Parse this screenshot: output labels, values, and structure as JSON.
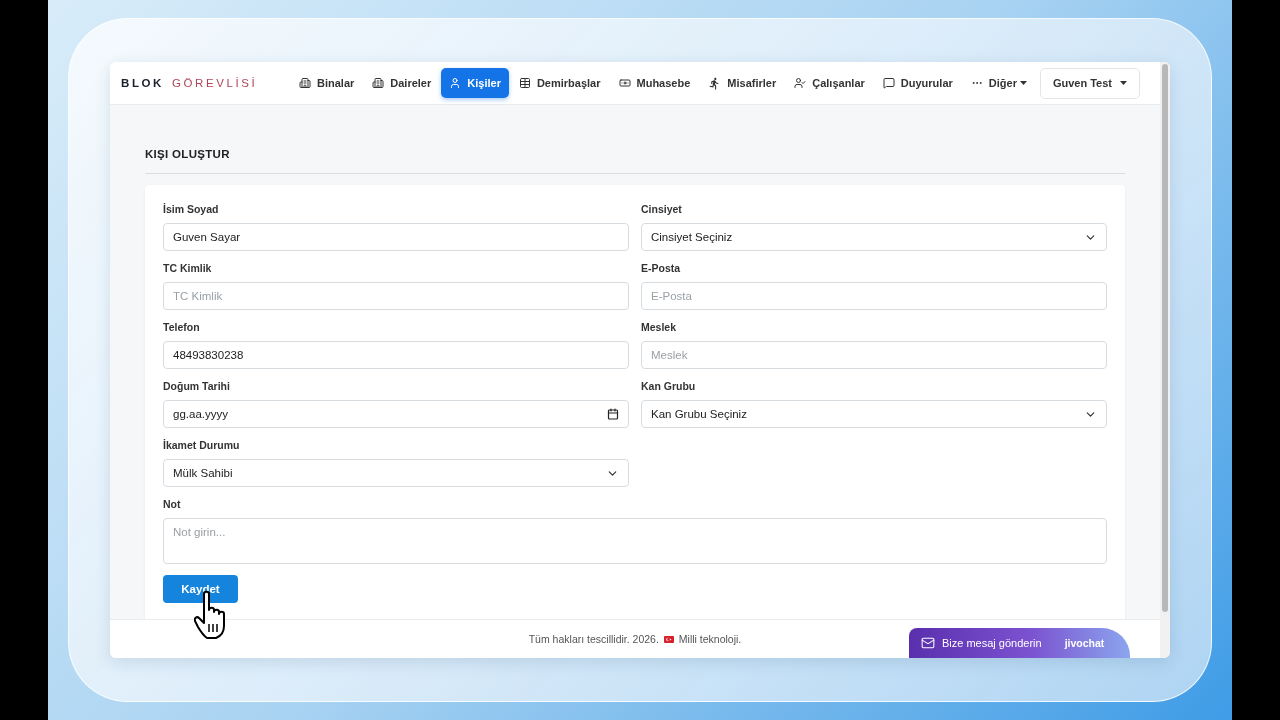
{
  "brand": {
    "first": "BLOK",
    "second": "GÖREVLİSİ"
  },
  "nav": [
    {
      "label": "Binalar",
      "selected": false,
      "dropdown": false
    },
    {
      "label": "Daireler",
      "selected": false,
      "dropdown": false
    },
    {
      "label": "Kişiler",
      "selected": true,
      "dropdown": false
    },
    {
      "label": "Demirbaşlar",
      "selected": false,
      "dropdown": false
    },
    {
      "label": "Muhasebe",
      "selected": false,
      "dropdown": false
    },
    {
      "label": "Misafirler",
      "selected": false,
      "dropdown": false
    },
    {
      "label": "Çalışanlar",
      "selected": false,
      "dropdown": false
    },
    {
      "label": "Duyurular",
      "selected": false,
      "dropdown": false
    },
    {
      "label": "Diğer",
      "selected": false,
      "dropdown": true
    }
  ],
  "user_menu": {
    "label": "Guven Test"
  },
  "page_title": "KIŞI OLUŞTUR",
  "form": {
    "fields": [
      {
        "label": "İsim Soyad",
        "kind": "text",
        "value": "Guven Sayar"
      },
      {
        "label": "Cinsiyet",
        "kind": "select",
        "value": "Cinsiyet Seçiniz"
      },
      {
        "label": "TC Kimlik",
        "kind": "text",
        "placeholder": "TC Kimlik"
      },
      {
        "label": "E-Posta",
        "kind": "text",
        "placeholder": "E-Posta"
      },
      {
        "label": "Telefon",
        "kind": "text",
        "value": "48493830238"
      },
      {
        "label": "Meslek",
        "kind": "text",
        "placeholder": "Meslek"
      },
      {
        "label": "Doğum Tarihi",
        "kind": "date",
        "value": "gg.aa.yyyy"
      },
      {
        "label": "Kan Grubu",
        "kind": "select",
        "value": "Kan Grubu Seçiniz"
      },
      {
        "label": "İkamet Durumu",
        "kind": "select",
        "value": "Mülk Sahibi"
      },
      {
        "label": "Not",
        "kind": "textarea",
        "placeholder": "Not girin..."
      }
    ],
    "submit": "Kaydet"
  },
  "footer": {
    "text": "Tüm hakları tescillidir. 2026.",
    "tagline": "Milli teknoloji."
  },
  "chat_widget": {
    "label": "Bize mesaj gönderin",
    "brand": "jivochat"
  }
}
